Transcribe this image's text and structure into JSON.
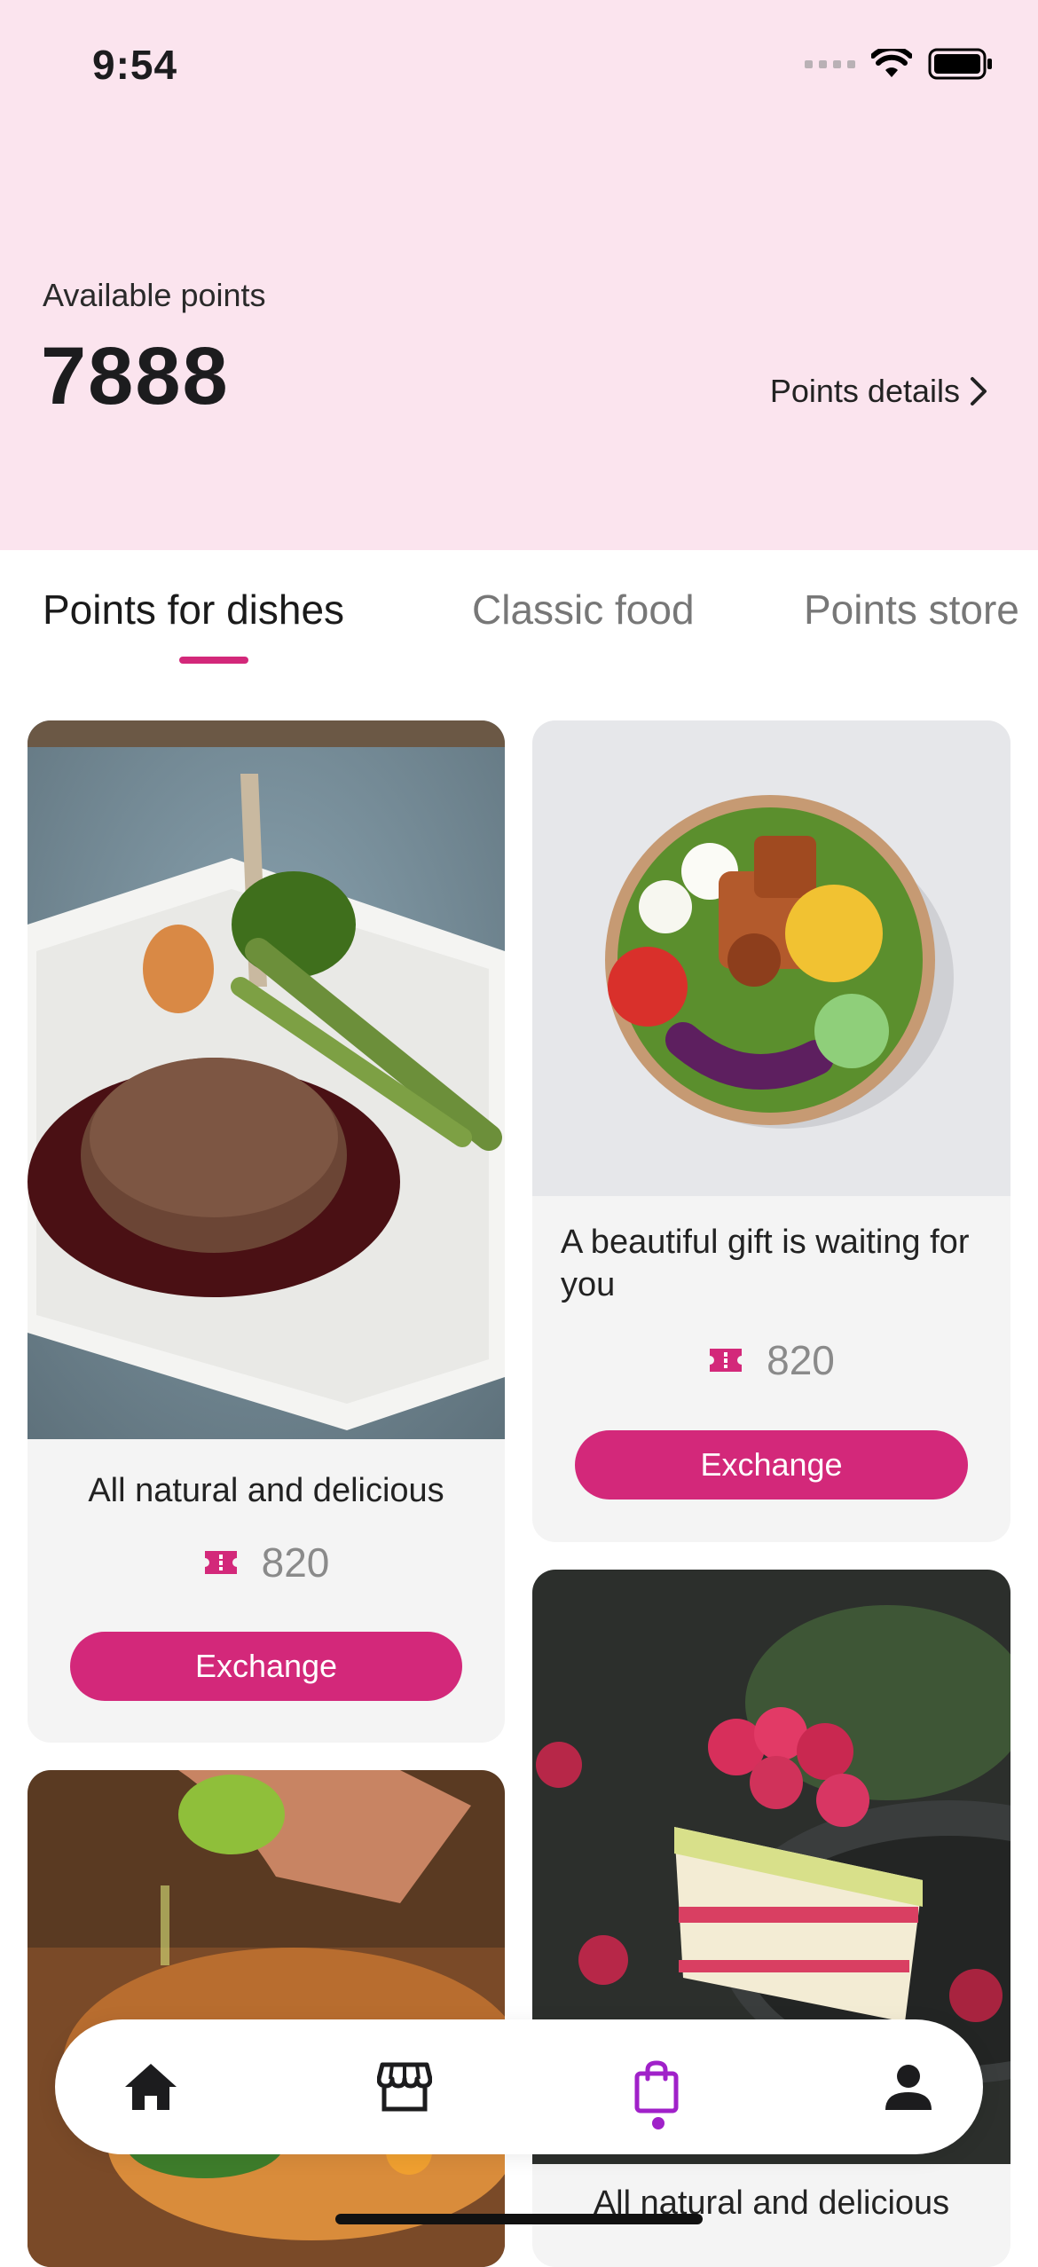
{
  "status_bar": {
    "time": "9:54"
  },
  "header": {
    "label": "Available points",
    "points": "7888",
    "details_link": "Points details"
  },
  "tabs": [
    {
      "label": "Points for dishes",
      "active": true
    },
    {
      "label": "Classic food",
      "active": false
    },
    {
      "label": "Points store",
      "active": false
    }
  ],
  "cards": [
    {
      "title": "All natural and delicious",
      "points": "820",
      "button": "Exchange",
      "image": "steak-photo"
    },
    {
      "title": "A beautiful gift is waiting for you",
      "points": "820",
      "button": "Exchange",
      "image": "salad-bowl-photo"
    },
    {
      "image": "tacos-photo"
    },
    {
      "title": "All natural and delicious",
      "image": "raspberry-cake-photo"
    }
  ],
  "bottom_nav": {
    "items": [
      {
        "icon": "home-icon",
        "active": false
      },
      {
        "icon": "store-icon",
        "active": false
      },
      {
        "icon": "shopping-bag-icon",
        "active": true
      },
      {
        "icon": "profile-icon",
        "active": false
      }
    ]
  },
  "colors": {
    "header_bg": "#fbe4ee",
    "accent": "#d3287a",
    "nav_active": "#a021c9"
  }
}
